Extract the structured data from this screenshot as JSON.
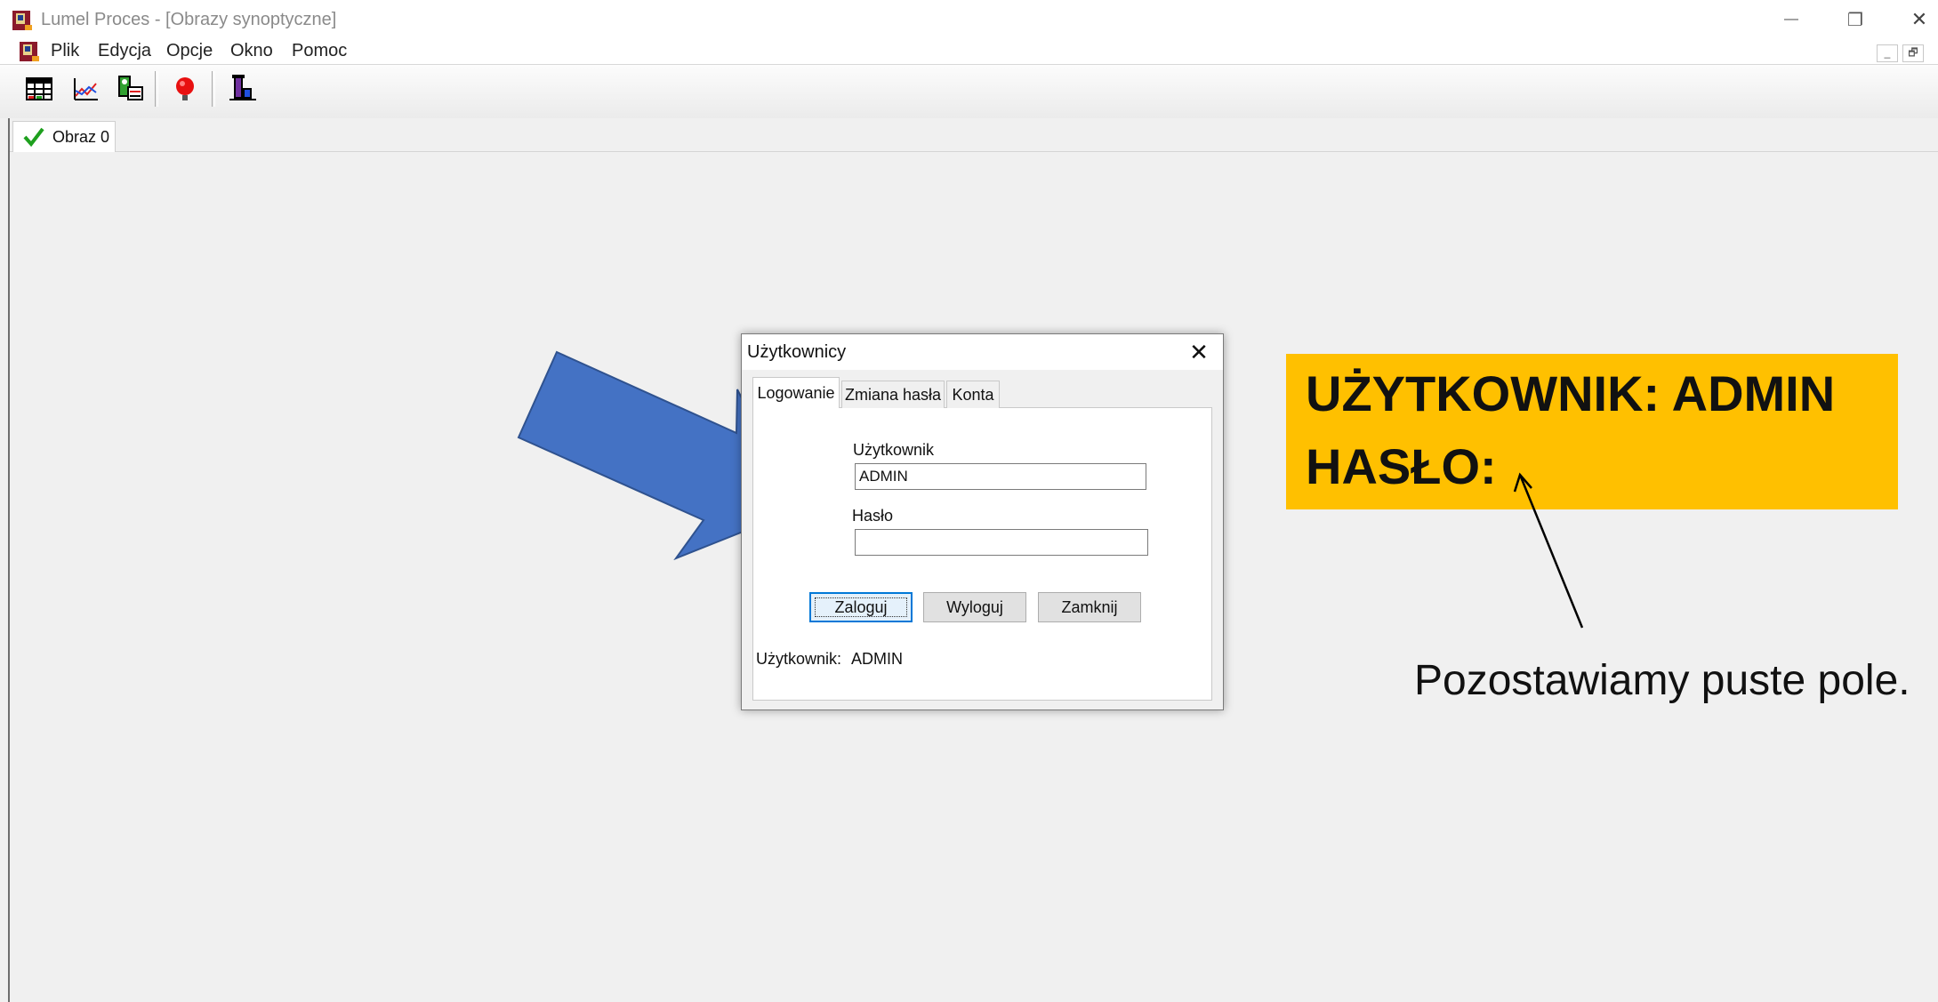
{
  "window": {
    "title": "Lumel Proces - [Obrazy synoptyczne]",
    "controls": {
      "minimize": "—",
      "restore": "❐",
      "close": "✕"
    }
  },
  "menu": {
    "items": [
      "Plik",
      "Edycja",
      "Opcje",
      "Okno",
      "Pomoc"
    ],
    "mdi_minimize": "_",
    "mdi_restore": "🗗"
  },
  "toolbar": {
    "buttons": [
      "table-icon",
      "chart-icon",
      "report-icon",
      "alarm-icon",
      "process-icon"
    ]
  },
  "tabs": {
    "active": "Obraz 0"
  },
  "dialog": {
    "title": "Użytkownicy",
    "close": "✕",
    "tabs": [
      "Logowanie",
      "Zmiana hasła",
      "Konta"
    ],
    "user_label": "Użytkownik",
    "user_value": "ADMIN",
    "password_label": "Hasło",
    "password_value": "",
    "buttons": {
      "login": "Zaloguj",
      "logout": "Wyloguj",
      "close": "Zamknij"
    },
    "status_label": "Użytkownik:",
    "status_value": "ADMIN"
  },
  "annotation": {
    "line1": "UŻYTKOWNIK: ADMIN",
    "line2": "HASŁO:",
    "note": "Pozostawiamy puste pole.",
    "colors": {
      "box": "#ffc000",
      "arrow": "#4472c4"
    }
  }
}
